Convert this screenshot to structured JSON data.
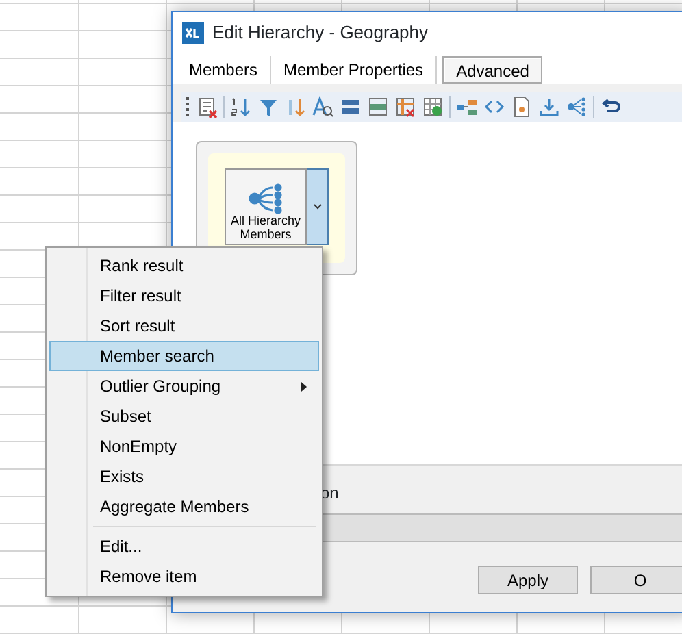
{
  "window": {
    "title": "Edit Hierarchy - Geography"
  },
  "tabs": [
    {
      "label": "Members",
      "selected": false
    },
    {
      "label": "Member Properties",
      "selected": false
    },
    {
      "label": "Advanced",
      "selected": true
    }
  ],
  "tile": {
    "label": "All Hierarchy Members"
  },
  "hidden_label": "on",
  "buttons": [
    "Apply",
    "O"
  ],
  "context_menu": [
    {
      "kind": "item",
      "label": "Rank result",
      "selected": false
    },
    {
      "kind": "item",
      "label": "Filter result",
      "selected": false
    },
    {
      "kind": "item",
      "label": "Sort result",
      "selected": false
    },
    {
      "kind": "item",
      "label": "Member search",
      "selected": true
    },
    {
      "kind": "submenu",
      "label": "Outlier Grouping",
      "selected": false
    },
    {
      "kind": "item",
      "label": "Subset",
      "selected": false
    },
    {
      "kind": "item",
      "label": "NonEmpty",
      "selected": false
    },
    {
      "kind": "item",
      "label": "Exists",
      "selected": false
    },
    {
      "kind": "item",
      "label": "Aggregate Members",
      "selected": false
    },
    {
      "kind": "separator"
    },
    {
      "kind": "item",
      "label": "Edit...",
      "selected": false
    },
    {
      "kind": "item",
      "label": "Remove item",
      "selected": false
    }
  ]
}
